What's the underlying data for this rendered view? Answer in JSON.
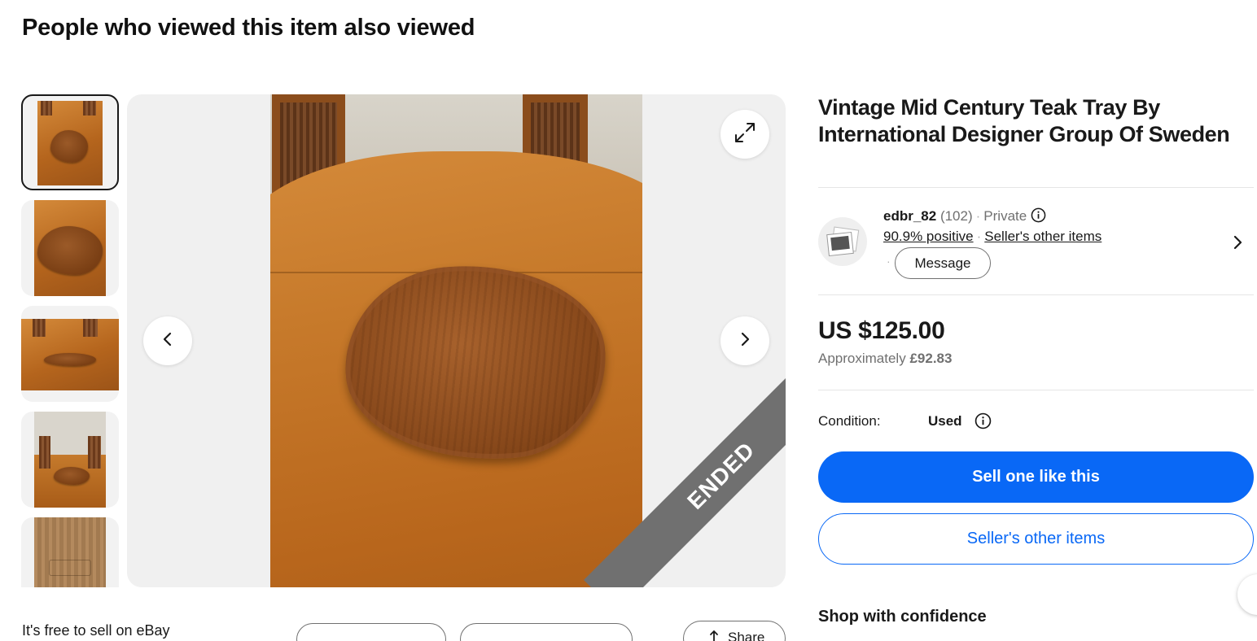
{
  "section_heading": "People who viewed this item also viewed",
  "gallery": {
    "ended_label": "ENDED",
    "expand_icon": "expand-icon",
    "prev_icon": "chevron-left-icon",
    "next_icon": "chevron-right-icon",
    "thumbnail_count": 5,
    "selected_thumbnail": 1
  },
  "listing": {
    "title": "Vintage Mid Century Teak Tray By International Designer Group Of Sweden",
    "price": "US $125.00",
    "approx_label": "Approximately",
    "approx_value": "£92.83",
    "condition_label": "Condition:",
    "condition_value": "Used"
  },
  "seller": {
    "username": "edbr_82",
    "feedback_count": "(102)",
    "private_label": "Private",
    "positive": "90.9% positive",
    "other_items": "Seller's other items",
    "message_button": "Message"
  },
  "actions": {
    "primary": "Sell one like this",
    "secondary": "Seller's other items"
  },
  "shop_with_confidence": "Shop with confidence",
  "footer": {
    "free_to_sell": "It's free to sell on eBay",
    "share_label": "Share"
  },
  "colors": {
    "primary_blue": "#0968f6",
    "ended_ribbon": "#707070",
    "muted_text": "#707070"
  }
}
